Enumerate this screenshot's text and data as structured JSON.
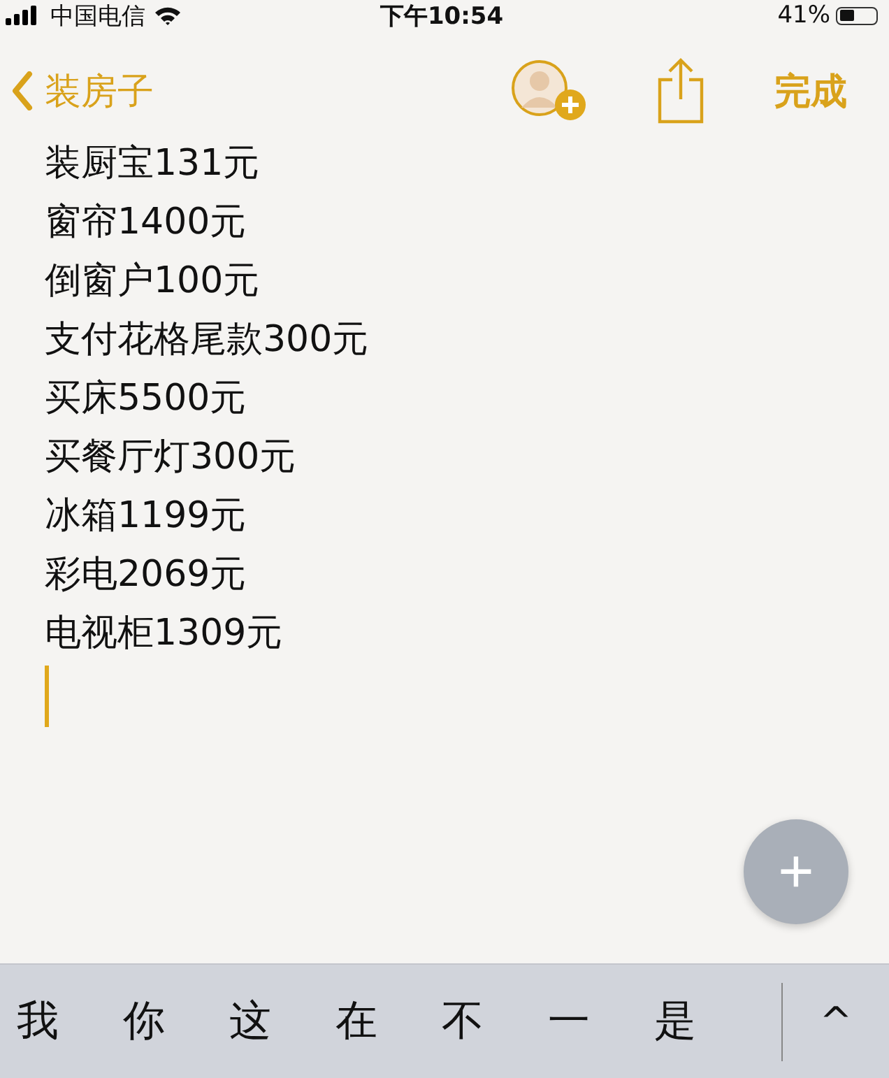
{
  "status_bar": {
    "carrier": "中国电信",
    "time": "下午10:54",
    "battery_text": "41%"
  },
  "nav_bar": {
    "back_label": "装房子",
    "done_label": "完成"
  },
  "note": {
    "lines": [
      "装厨宝131元",
      "窗帘1400元",
      "倒窗户100元",
      "支付花格尾款300元",
      "买床5500元",
      "买餐厅灯300元",
      "冰箱1199元",
      "彩电2069元",
      "电视柜1309元"
    ],
    "editing": true
  },
  "add_button": {
    "label": "+"
  },
  "candidate_bar": {
    "candidates": [
      "我",
      "你",
      "这",
      "在",
      "不",
      "一",
      "是"
    ],
    "expand_label": "^"
  }
}
